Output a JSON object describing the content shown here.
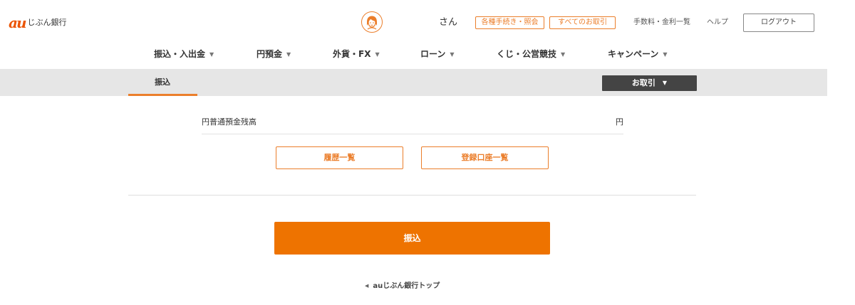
{
  "header": {
    "logo_mark": "au",
    "logo_text": "じぶん銀行",
    "user_name": "さん",
    "buttons": {
      "procedures": "各種手続き・照会",
      "all_transactions": "すべてのお取引"
    },
    "links": {
      "fees": "手数料・金利一覧",
      "help": "ヘルプ"
    },
    "logout_label": "ログアウト"
  },
  "global_nav": {
    "items": [
      {
        "label": "振込・入出金"
      },
      {
        "label": "円預金"
      },
      {
        "label": "外貨・FX"
      },
      {
        "label": "ローン"
      },
      {
        "label": "くじ・公営競技"
      },
      {
        "label": "キャンペーン"
      }
    ],
    "caret": "▼"
  },
  "sub_nav": {
    "active_tab": "振込",
    "trade_button": "お取引",
    "caret": "▼"
  },
  "main": {
    "balance_label": "円普通預金残高",
    "balance_unit": "円",
    "history_button": "履歴一覧",
    "registered_accounts_button": "登録口座一覧",
    "transfer_button": "振込",
    "top_link": "auじぶん銀行トップ",
    "top_link_arrow": "◀"
  },
  "colors": {
    "brand_orange": "#ee7300",
    "accent_orange": "#eb7e2b",
    "dark_button": "#444444",
    "subnav_bg": "#e6e6e6"
  },
  "icons": {
    "avatar": "user-avatar-icon",
    "dropdown": "caret-down-icon",
    "back": "triangle-left-icon"
  }
}
